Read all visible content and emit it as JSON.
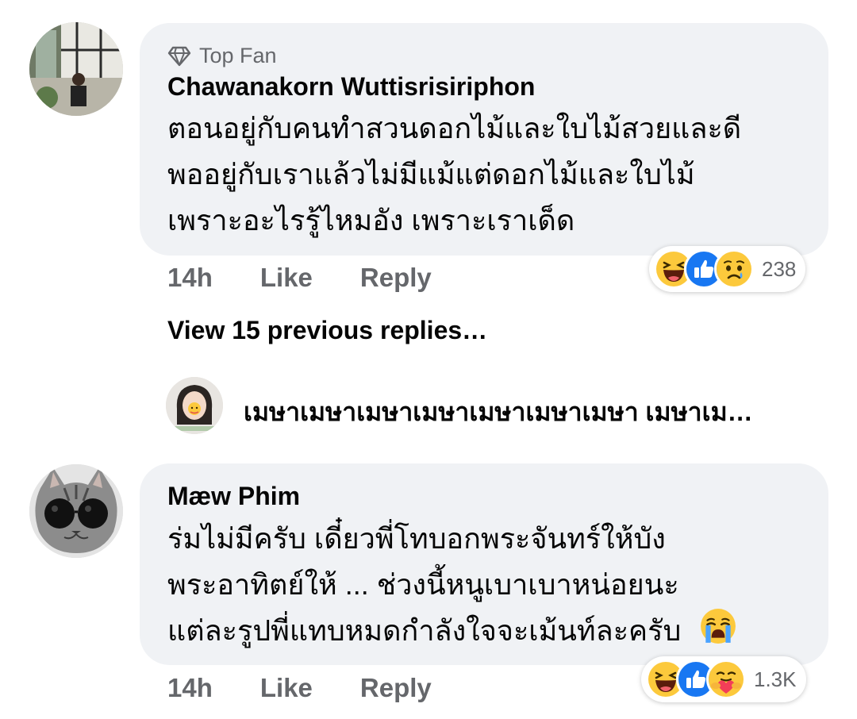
{
  "comment1": {
    "badge": "Top Fan",
    "author": "Chawanakorn Wuttisrisiriphon",
    "lines": [
      "ตอนอยู่กับคนทำสวนดอกไม้และใบไม้สวยและดี",
      "พออยู่กับเราแล้วไม่มีแม้แต่ดอกไม้และใบไม้",
      "เพราะอะไรรู้ไหมอัง เพราะเราเด็ด"
    ],
    "time": "14h",
    "like_label": "Like",
    "reply_label": "Reply",
    "reactions": [
      "haha-icon",
      "like-icon",
      "sad-icon"
    ],
    "reaction_count": "238"
  },
  "view_replies": "View 15 previous replies…",
  "reply_preview": {
    "text": "เมษาเมษาเมษาเมษาเมษาเมษาเมษา เมษาเม…"
  },
  "comment2": {
    "author": "Mæw Phim",
    "lines": [
      "ร่มไม่มีครับ เดี๋ยวพี่โทบอกพระจันทร์ให้บัง",
      "พระอาทิตย์ให้ ... ช่วงนี้หนูเบาเบาหน่อยนะ",
      "แต่ละรูปพี่แทบหมดกำลังใจจะเม้นท์ละครับ"
    ],
    "inline_emoji": "crying-face-icon",
    "time": "14h",
    "like_label": "Like",
    "reply_label": "Reply",
    "reactions": [
      "haha-icon",
      "like-icon",
      "care-icon"
    ],
    "reaction_count": "1.3K"
  },
  "colors": {
    "bubble": "#f0f2f5",
    "secondary_text": "#65676b",
    "like_blue": "#1877f2",
    "emoji_yellow": "#fcc93c"
  }
}
